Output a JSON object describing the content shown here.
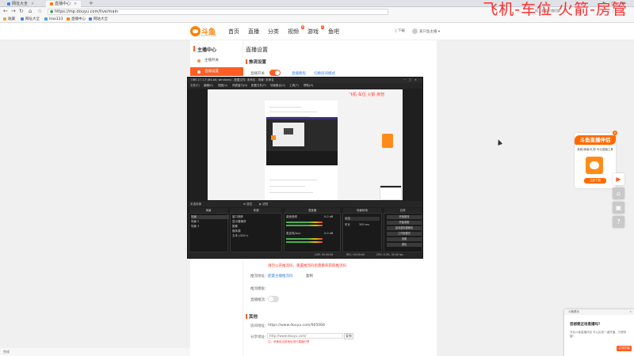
{
  "browser": {
    "tabs": [
      {
        "label": "网址大全",
        "color": "#3b84e8"
      },
      {
        "label": "直播中心",
        "color": "#ff7f00"
      }
    ],
    "url": "https://mp.douyu.com/live/main",
    "bookmarks": [
      "收藏",
      "网址大全",
      "Hao123",
      "直播中心",
      "网站大全"
    ]
  },
  "watermark": "飞机-车位 火箭-房管",
  "watermark_small": "网上看看主播招募",
  "site": {
    "logo_text": "斗鱼",
    "logo_sub": "DOUYU.COM",
    "nav": [
      "首页",
      "直播",
      "分类",
      "视频",
      "游戏",
      "鱼吧"
    ],
    "nav_badges": {
      "视频": "6",
      "游戏": "1"
    },
    "header_right": {
      "download": "下载",
      "user": "某只鱼主播"
    }
  },
  "sidebar": {
    "title": "主播中心",
    "items": [
      {
        "label": "主播开关",
        "active": false
      },
      {
        "label": "直播设置",
        "active": true
      }
    ]
  },
  "main": {
    "title": "直播设置",
    "push_section": "推流设置",
    "live_switch_label": "直播开关",
    "live_switch_on": true,
    "top_links": [
      "直播教程",
      "切换房间模式"
    ],
    "warning_text": "请勿公开推流码，重置推流码后需重新获取推流码",
    "rtmp_label": "推流地址：",
    "rtmp_value": "配置主播推流码",
    "rtmp_copy": "复制",
    "switch_label": "推流模板：",
    "live_push_label": "直播推流：",
    "other_section": "其他",
    "room_url_label": "房间地址：",
    "room_url": "https://www.douyu.com/905068",
    "share_label": "分享地址：",
    "share_url": "http://www.douyu.com/",
    "share_hint": "注：请使用当前地址进行直播分享",
    "copy_btn": "复制"
  },
  "promo": {
    "banner": "斗鱼直播伴侣",
    "desc": "美颜/弹幕/礼物 专业直播工具",
    "button": "立即下载"
  },
  "float_buttons": [
    "play",
    "home",
    "app",
    "help"
  ],
  "notify": {
    "header": "斗鱼提示",
    "title": "您想要这场直播吗？",
    "desc": "开启斗鱼直播伴侣 可以实现一键开播，方便快捷！",
    "button": "立即开播"
  },
  "status_text": "完成",
  "obs": {
    "title": "OBS 27.1.3 (64-bit, windows) - 配置文件: 未命名 - 场景: 未命名",
    "menu": [
      "文件(F)",
      "编辑(E)",
      "视图(V)",
      "停靠窗口(D)",
      "配置文件(P)",
      "场景集合(S)",
      "工具(T)",
      "帮助(H)"
    ],
    "split_left": "未选择源",
    "split_mid": [
      "属性",
      "滤镜"
    ],
    "docks": {
      "scenes": {
        "title": "场景",
        "items": [
          "场景",
          "场景 2",
          "场景 3"
        ]
      },
      "sources": {
        "title": "来源",
        "items": [
          "窗口捕获",
          "显示器捕获",
          "图像",
          "媒体源",
          "文本 (GDI+)"
        ]
      },
      "mixer": {
        "title": "混音器",
        "channels": [
          {
            "name": "桌面音频",
            "db": "0.0 dB"
          },
          {
            "name": "麦克风/Aux",
            "db": "0.0 dB"
          }
        ]
      },
      "transitions": {
        "title": "场景转场",
        "fade": "淡出",
        "duration_label": "时长",
        "duration": "300 ms"
      },
      "controls": {
        "title": "控件",
        "buttons": [
          "开始推流",
          "开始录制",
          "启动虚拟摄像机",
          "工作室模式",
          "设置",
          "退出"
        ]
      }
    },
    "status": {
      "live": "LIVE: 00:00:00",
      "rec": "REC: 00:00:00",
      "cpu": "CPU: 0.3%, 30.00 fps"
    }
  },
  "colors": {
    "accent": "#ff5d23",
    "link": "#3b84e8",
    "watermark": "#ff2d2d"
  }
}
